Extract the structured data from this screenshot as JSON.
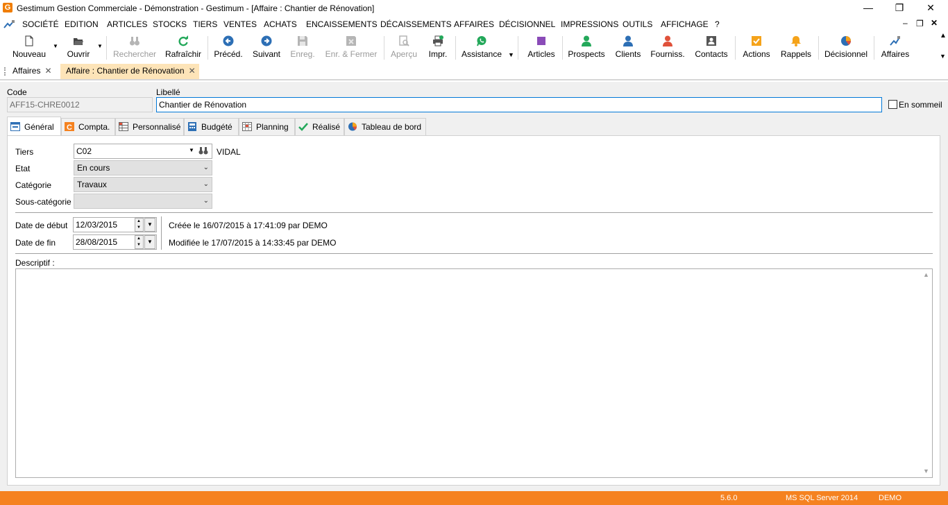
{
  "window": {
    "title": "Gestimum Gestion Commerciale - Démonstration - Gestimum - [Affaire : Chantier de Rénovation]",
    "app_icon_letter": "G"
  },
  "menu": [
    "SOCIÉTÉ",
    "EDITION",
    "ARTICLES",
    "STOCKS",
    "TIERS",
    "VENTES",
    "ACHATS",
    "ENCAISSEMENTS",
    "DÉCAISSEMENTS",
    "AFFAIRES",
    "DÉCISIONNEL",
    "IMPRESSIONS",
    "OUTILS",
    "AFFICHAGE",
    "?"
  ],
  "toolbar": [
    {
      "label": "Nouveau",
      "icon": "new-document-icon",
      "enabled": true
    },
    {
      "label": "Ouvrir",
      "icon": "open-folder-icon",
      "enabled": true
    },
    {
      "label": "Rechercher",
      "icon": "binoculars-icon",
      "enabled": false
    },
    {
      "label": "Rafraîchir",
      "icon": "refresh-icon",
      "enabled": true
    },
    {
      "label": "Précéd.",
      "icon": "arrow-left-icon",
      "enabled": true
    },
    {
      "label": "Suivant",
      "icon": "arrow-right-icon",
      "enabled": true
    },
    {
      "label": "Enreg.",
      "icon": "save-icon",
      "enabled": false
    },
    {
      "label": "Enr. & Fermer",
      "icon": "save-close-icon",
      "enabled": false
    },
    {
      "label": "Aperçu",
      "icon": "preview-icon",
      "enabled": false
    },
    {
      "label": "Impr.",
      "icon": "printer-icon",
      "enabled": true
    },
    {
      "label": "Assistance",
      "icon": "whatsapp-icon",
      "enabled": true
    },
    {
      "label": "Articles",
      "icon": "articles-icon",
      "enabled": true
    },
    {
      "label": "Prospects",
      "icon": "person-green-icon",
      "enabled": true
    },
    {
      "label": "Clients",
      "icon": "person-blue-icon",
      "enabled": true
    },
    {
      "label": "Fourniss.",
      "icon": "person-red-icon",
      "enabled": true
    },
    {
      "label": "Contacts",
      "icon": "contact-card-icon",
      "enabled": true
    },
    {
      "label": "Actions",
      "icon": "checkbox-orange-icon",
      "enabled": true
    },
    {
      "label": "Rappels",
      "icon": "bell-icon",
      "enabled": true
    },
    {
      "label": "Décisionnel",
      "icon": "pie-chart-icon",
      "enabled": true
    },
    {
      "label": "Affaires",
      "icon": "affaires-icon",
      "enabled": true
    }
  ],
  "doc_tabs": [
    {
      "label": "Affaires",
      "active": false
    },
    {
      "label": "Affaire : Chantier de Rénovation",
      "active": true
    }
  ],
  "header": {
    "code_label": "Code",
    "code_value": "AFF15-CHRE0012",
    "libelle_label": "Libellé",
    "libelle_value": "Chantier de Rénovation",
    "sommeil_label": "En sommeil"
  },
  "tabs": [
    "Général",
    "Compta.",
    "Personnalisé",
    "Budgété",
    "Planning",
    "Réalisé",
    "Tableau de bord"
  ],
  "general": {
    "tiers_label": "Tiers",
    "tiers_value": "C02",
    "tiers_name": "VIDAL",
    "etat_label": "Etat",
    "etat_value": "En cours",
    "categorie_label": "Catégorie",
    "categorie_value": "Travaux",
    "souscat_label": "Sous-catégorie",
    "souscat_value": "",
    "date_debut_label": "Date de début",
    "date_debut_value": "12/03/2015",
    "date_fin_label": "Date de fin",
    "date_fin_value": "28/08/2015",
    "created_text": "Créée le 16/07/2015 à 17:41:09 par DEMO",
    "modified_text": "Modifiée le 17/07/2015 à 14:33:45 par DEMO",
    "descriptif_label": "Descriptif :"
  },
  "status": {
    "version": "5.6.0",
    "server": "MS SQL Server 2014",
    "user": "DEMO"
  },
  "colors": {
    "accent": "#f58220",
    "active_doc_tab": "#fde4b8",
    "focus_border": "#0078d7"
  }
}
